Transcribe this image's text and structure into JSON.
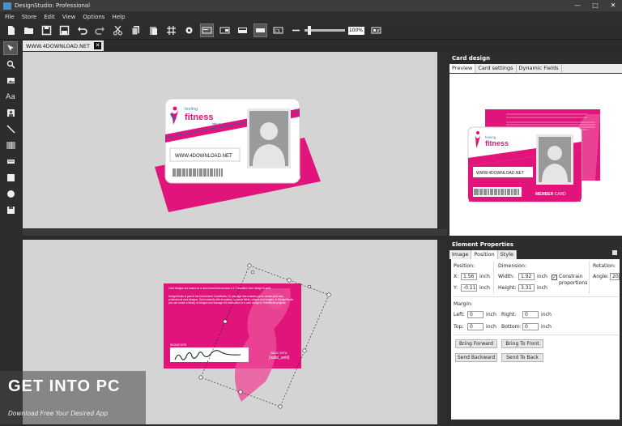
{
  "window": {
    "title": "DesignStudio: Professional",
    "controls": [
      "—",
      "□",
      "✕"
    ]
  },
  "menu": [
    "File",
    "Store",
    "Edit",
    "View",
    "Options",
    "Help"
  ],
  "toolbar": {
    "zoom": "100%"
  },
  "document_tab": {
    "label": "WWW.4DOWNLOAD.NET",
    "close": "✕"
  },
  "card_front": {
    "brand_small": "feeling",
    "brand": "fitness",
    "brand_tag": "with us",
    "name_label": "NAME",
    "name_value": "WWW.4DOWNLOAD.NET",
    "member_bold": "MEMBER",
    "member_rest": " CARD"
  },
  "card_back": {
    "paragraph1": "Card designs are based on a new format that ensures a 1:1 transition from design to print.",
    "paragraph2": "DesignStudio is part of the full-featured CardWorks 2.0 package that enables you to create your own, professional card designs. Start instantly with templates, dynamic fields, shapes and images. In DesignStudio you can create a library of designs and manage the distribution of a card design to PrintStudio projects.",
    "signature_label": "SIGNATURE",
    "valid_label": "VALID UNTIL",
    "valid_value": "{valid_until}"
  },
  "card_design_panel": {
    "title": "Card design",
    "tabs": [
      "Preview",
      "Card settings",
      "Dynamic Fields"
    ]
  },
  "element_properties": {
    "title": "Element Properties",
    "tabs": [
      "Image",
      "Position",
      "Style"
    ],
    "position_label": "Position:",
    "x_label": "X:",
    "x_value": "1.56",
    "y_label": "Y:",
    "y_value": "-0.11",
    "unit": "inch",
    "dimension_label": "Dimension:",
    "width_label": "Width:",
    "width_value": "1.92",
    "height_label": "Height:",
    "height_value": "3.31",
    "constrain_label": "Constrain proportions",
    "rotation_label": "Rotation:",
    "angle_label": "Angle:",
    "angle_value": "20.",
    "margin_label": "Margin:",
    "left_label": "Left:",
    "left_value": "0",
    "right_label": "Right:",
    "right_value": "0",
    "top_label": "Top:",
    "top_value": "0",
    "bottom_label": "Bottom:",
    "bottom_value": "0",
    "bring_forward": "Bring Forward",
    "bring_front": "Bring To Front",
    "send_backward": "Send Backward",
    "send_back": "Send To Back"
  },
  "watermark": {
    "text": "GET INTO PC",
    "sub": "Download Free Your Desired App"
  },
  "colors": {
    "accent": "#e0147a",
    "canvas": "#d4d4d4",
    "chrome": "#2d2d2d"
  }
}
